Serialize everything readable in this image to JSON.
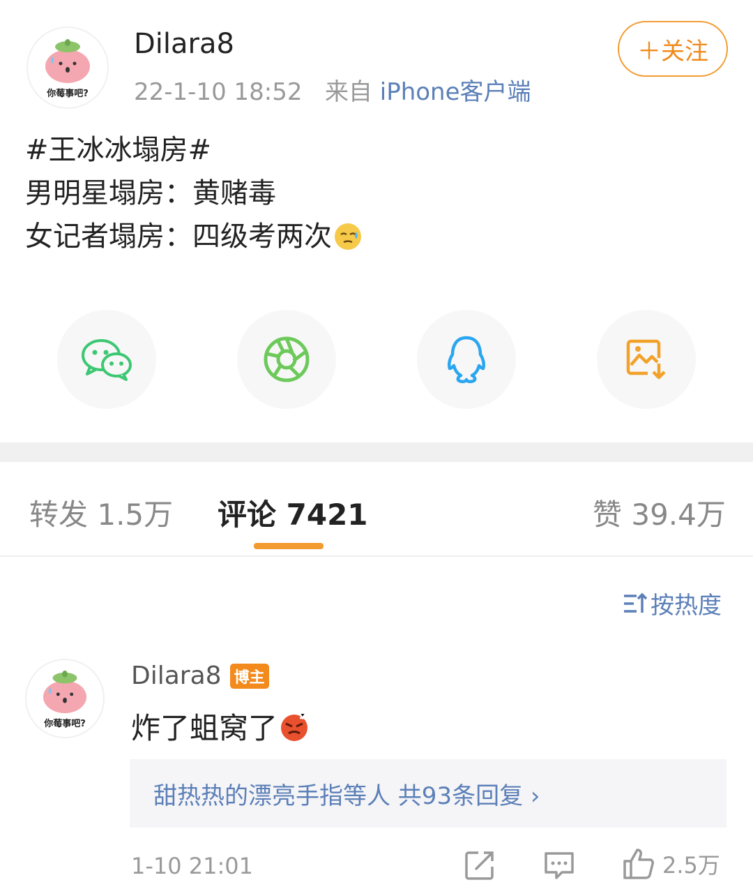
{
  "post": {
    "author": "Dilara8",
    "avatar_caption": "你莓事吧?",
    "time": "22-1-10 18:52",
    "source_prefix": "来自",
    "source": "iPhone客户端",
    "follow_label": "＋关注",
    "lines": [
      "#王冰冰塌房#",
      "男明星塌房：黄赌毒",
      "女记者塌房：四级考两次"
    ],
    "trailing_emoji": "sweat-emoji"
  },
  "share": [
    {
      "icon": "wechat-icon",
      "color": "#3cc773"
    },
    {
      "icon": "moments-icon",
      "color": "#6cc95a"
    },
    {
      "icon": "qq-icon",
      "color": "#2aa6f0"
    },
    {
      "icon": "save-image-icon",
      "color": "#f2a22a"
    }
  ],
  "tabs": {
    "repost": "转发 1.5万",
    "comments": "评论 7421",
    "likes": "赞 39.4万"
  },
  "sort_label": "按热度",
  "comment": {
    "author": "Dilara8",
    "avatar_caption": "你莓事吧?",
    "badge": "博主",
    "text": "炸了蛆窝了",
    "emoji": "angry-emoji",
    "replies": "甜热热的漂亮手指等人  共93条回复 ›",
    "time": "1-10 21:01",
    "like_count": "2.5万"
  },
  "colors": {
    "accent": "#f29b30",
    "link": "#5b7fb8",
    "muted": "#999999"
  }
}
